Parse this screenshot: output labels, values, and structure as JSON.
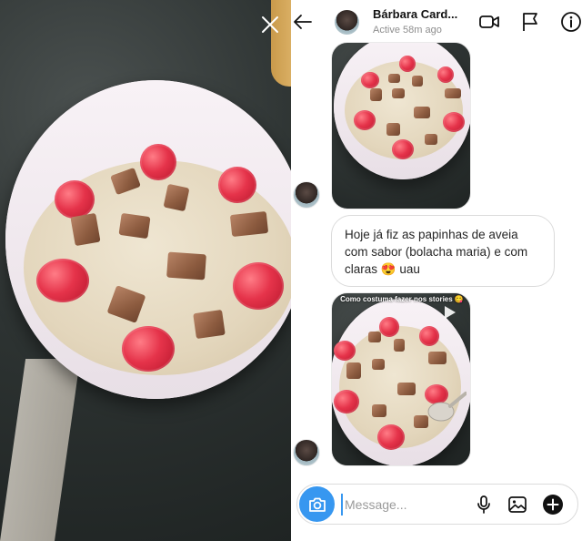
{
  "story_viewer": {
    "close_icon": "close-icon"
  },
  "thread": {
    "header": {
      "back_icon": "arrow-left-icon",
      "name": "Bárbara Card...",
      "status": "Active 58m ago",
      "video_icon": "video-camera-icon",
      "flag_icon": "flag-icon",
      "info_icon": "info-icon"
    },
    "messages": [
      {
        "type": "photo"
      },
      {
        "type": "text",
        "text": "Hoje já fiz as papinhas de aveia com sabor (bolacha maria) e com claras 😍 uau"
      },
      {
        "type": "story_reply",
        "caption": "Como costuma fazer nos stories 😋",
        "play_icon": "play-icon"
      }
    ]
  },
  "composer": {
    "camera_icon": "camera-icon",
    "placeholder": "Message...",
    "mic_icon": "microphone-icon",
    "gallery_icon": "image-gallery-icon",
    "add_icon": "plus-circle-icon"
  },
  "colors": {
    "accent": "#3797f0",
    "bubble_border": "#dbdbdb",
    "secondary_text": "#8e8e8e"
  }
}
